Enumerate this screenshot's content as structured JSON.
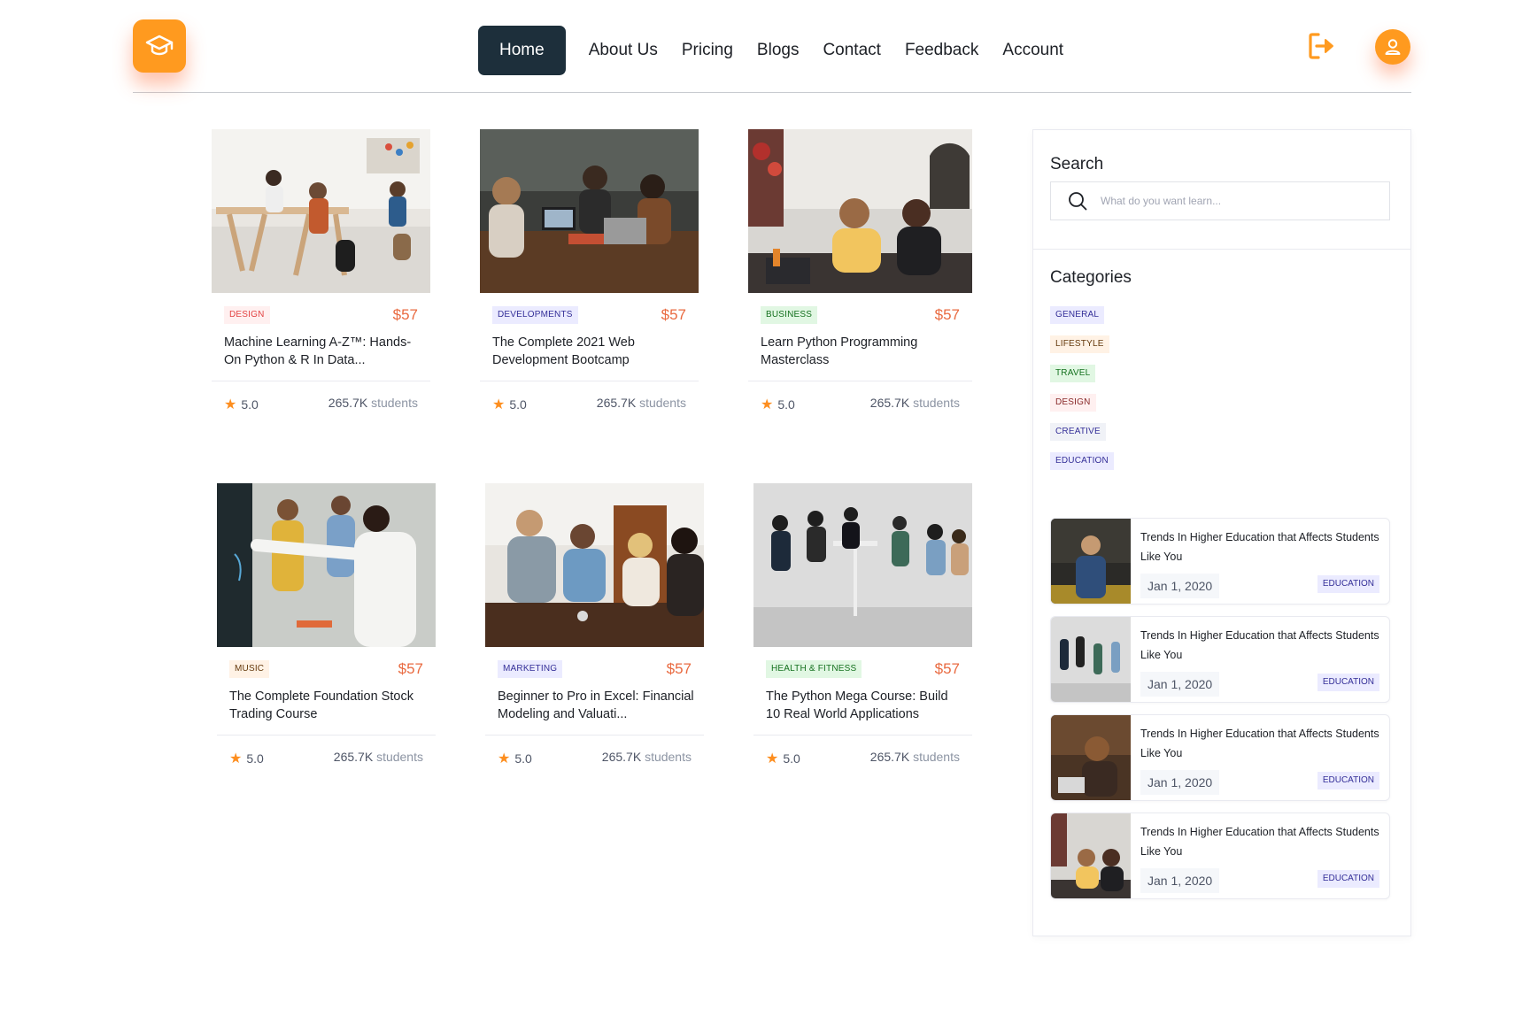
{
  "header": {
    "nav": [
      {
        "label": "Home",
        "active": true
      },
      {
        "label": "About Us"
      },
      {
        "label": "Pricing"
      },
      {
        "label": "Blogs"
      },
      {
        "label": "Contact"
      },
      {
        "label": "Feedback"
      },
      {
        "label": "Account"
      }
    ],
    "accent_color": "#ff9a1f",
    "nav_active_color": "#1d2f3b"
  },
  "courses": [
    {
      "tag": "Design",
      "tag_color": "#e34444",
      "tag_bg": "#fff0f0",
      "price": "$57",
      "title": "Machine Learning A-Z™: Hands-On Python & R In Data...",
      "rating": "5.0",
      "students": "265.7K",
      "students_label": "students"
    },
    {
      "tag": "Developments",
      "tag_color": "#342f98",
      "tag_bg": "#ebebff",
      "price": "$57",
      "title": "The Complete 2021 Web Development Bootcamp",
      "rating": "5.0",
      "students": "265.7K",
      "students_label": "students"
    },
    {
      "tag": "Business",
      "tag_color": "#15711f",
      "tag_bg": "#e1f7e3",
      "price": "$57",
      "title": "Learn Python Programming Masterclass",
      "rating": "5.0",
      "students": "265.7K",
      "students_label": "students"
    },
    {
      "tag": "Music",
      "tag_color": "#65390c",
      "tag_bg": "#fff2e5",
      "price": "$57",
      "title": "The Complete Foundation Stock Trading Course",
      "rating": "5.0",
      "students": "265.7K",
      "students_label": "students"
    },
    {
      "tag": "Marketing",
      "tag_color": "#342f98",
      "tag_bg": "#ebebff",
      "price": "$57",
      "title": "Beginner to Pro in Excel: Financial Modeling and Valuati...",
      "rating": "5.0",
      "students": "265.7K",
      "students_label": "students"
    },
    {
      "tag": "Health & Fitness",
      "tag_color": "#15711f",
      "tag_bg": "#e1f7e3",
      "price": "$57",
      "title": "The Python Mega Course: Build 10 Real World Applications",
      "rating": "5.0",
      "students": "265.7K",
      "students_label": "students"
    }
  ],
  "sidebar": {
    "search_title": "Search",
    "search_placeholder": "What do you want learn...",
    "categories_title": "Categories",
    "categories": [
      {
        "label": "General",
        "color": "#342f98",
        "bg": "#ebebff"
      },
      {
        "label": "Lifestyle",
        "color": "#65390c",
        "bg": "#fff2e5"
      },
      {
        "label": "Travel",
        "color": "#15711f",
        "bg": "#e1f7e3"
      },
      {
        "label": "Design",
        "color": "#882929",
        "bg": "#fff0f0"
      },
      {
        "label": "Creative",
        "color": "#342f98",
        "bg": "#f0f2f7"
      },
      {
        "label": "Education",
        "color": "#342f98",
        "bg": "#ebebff"
      }
    ],
    "posts": [
      {
        "title": "Trends In Higher Education that Affects Students Like You",
        "date": "Jan 1, 2020",
        "tag": "Education"
      },
      {
        "title": "Trends In Higher Education that Affects Students Like You",
        "date": "Jan 1, 2020",
        "tag": "Education"
      },
      {
        "title": "Trends In Higher Education that Affects Students Like You",
        "date": "Jan 1, 2020",
        "tag": "Education"
      },
      {
        "title": "Trends In Higher Education that Affects Students Like You",
        "date": "Jan 1, 2020",
        "tag": "Education"
      }
    ]
  }
}
